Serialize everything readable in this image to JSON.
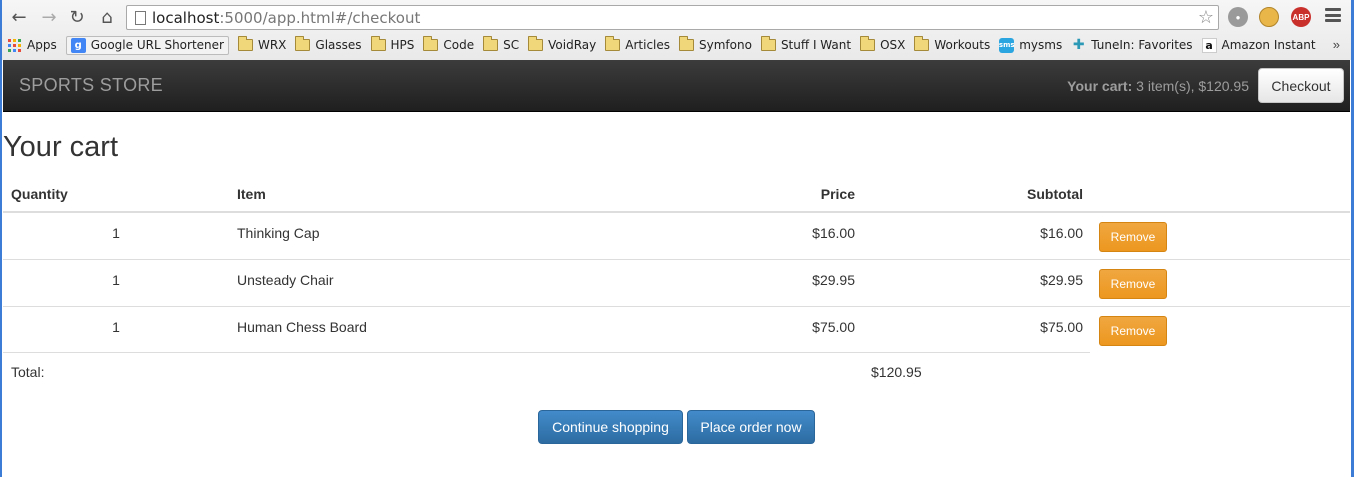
{
  "browser": {
    "url_host": "localhost",
    "url_rest": ":5000/app.html#/checkout",
    "bookmarks": [
      {
        "label": "Apps",
        "icon": "apps-grid-icon"
      },
      {
        "label": "Google URL Shortener",
        "icon": "google-icon"
      },
      {
        "label": "WRX",
        "icon": "folder-icon"
      },
      {
        "label": "Glasses",
        "icon": "folder-icon"
      },
      {
        "label": "HPS",
        "icon": "folder-icon"
      },
      {
        "label": "Code",
        "icon": "folder-icon"
      },
      {
        "label": "SC",
        "icon": "folder-icon"
      },
      {
        "label": "VoidRay",
        "icon": "folder-icon"
      },
      {
        "label": "Articles",
        "icon": "folder-icon"
      },
      {
        "label": "Symfono",
        "icon": "folder-icon"
      },
      {
        "label": "Stuff I Want",
        "icon": "folder-icon"
      },
      {
        "label": "OSX",
        "icon": "folder-icon"
      },
      {
        "label": "Workouts",
        "icon": "folder-icon"
      },
      {
        "label": "mysms",
        "icon": "mysms-icon"
      },
      {
        "label": "TuneIn: Favorites",
        "icon": "tunein-icon"
      },
      {
        "label": "Amazon Instant",
        "icon": "amazon-icon"
      }
    ],
    "more_label": "»",
    "abp_label": "ABP"
  },
  "navbar": {
    "brand": "SPORTS STORE",
    "cart_label": "Your cart:",
    "cart_summary": " 3 item(s), $120.95",
    "checkout_label": "Checkout"
  },
  "page": {
    "title": "Your cart"
  },
  "table": {
    "headers": {
      "quantity": "Quantity",
      "item": "Item",
      "price": "Price",
      "subtotal": "Subtotal"
    },
    "rows": [
      {
        "quantity": "1",
        "item": "Thinking Cap",
        "price": "$16.00",
        "subtotal": "$16.00",
        "action": "Remove"
      },
      {
        "quantity": "1",
        "item": "Unsteady Chair",
        "price": "$29.95",
        "subtotal": "$29.95",
        "action": "Remove"
      },
      {
        "quantity": "1",
        "item": "Human Chess Board",
        "price": "$75.00",
        "subtotal": "$75.00",
        "action": "Remove"
      }
    ],
    "total_label": "Total:",
    "total_value": "$120.95"
  },
  "actions": {
    "continue_label": "Continue shopping",
    "place_order_label": "Place order now"
  },
  "colors": {
    "navbar": "#222222",
    "remove_button": "#f0ad4e",
    "primary_button": "#337ab7"
  }
}
